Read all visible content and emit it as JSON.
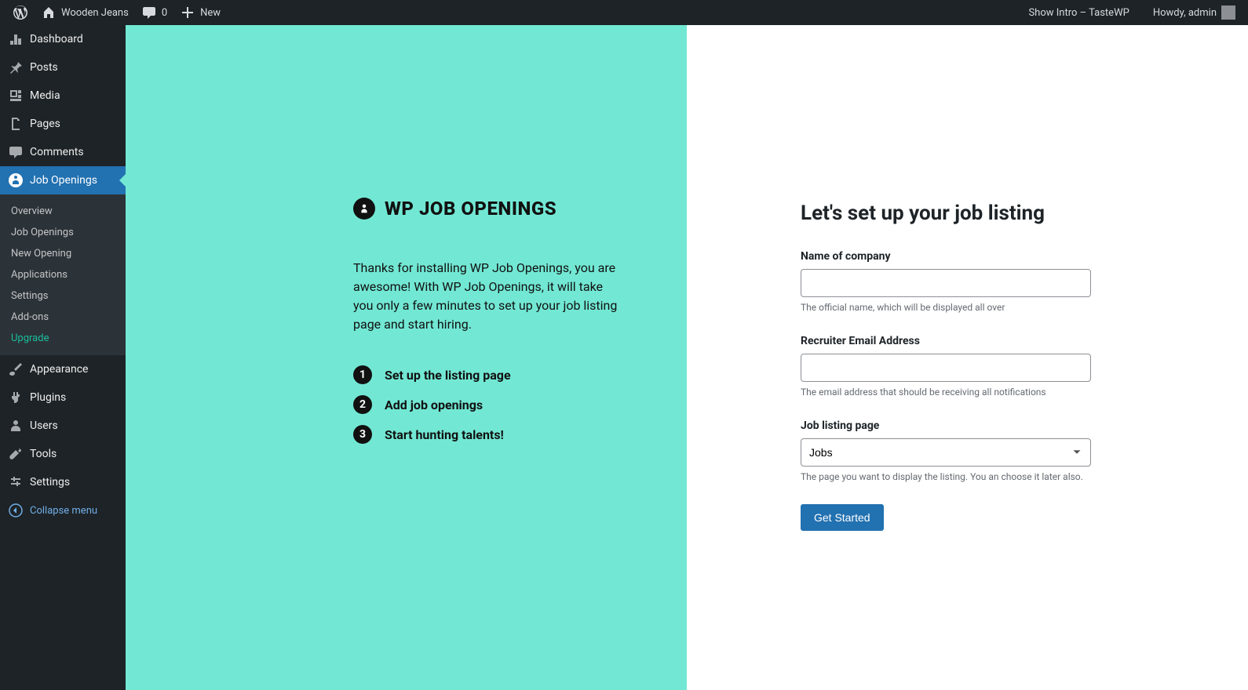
{
  "adminbar": {
    "site_name": "Wooden Jeans",
    "comments_count": "0",
    "new_label": "New",
    "show_intro": "Show Intro – TasteWP",
    "howdy": "Howdy, admin"
  },
  "sidebar": {
    "items": [
      {
        "label": "Dashboard"
      },
      {
        "label": "Posts"
      },
      {
        "label": "Media"
      },
      {
        "label": "Pages"
      },
      {
        "label": "Comments"
      },
      {
        "label": "Job Openings"
      },
      {
        "label": "Appearance"
      },
      {
        "label": "Plugins"
      },
      {
        "label": "Users"
      },
      {
        "label": "Tools"
      },
      {
        "label": "Settings"
      }
    ],
    "submenu": [
      {
        "label": "Overview"
      },
      {
        "label": "Job Openings"
      },
      {
        "label": "New Opening"
      },
      {
        "label": "Applications"
      },
      {
        "label": "Settings"
      },
      {
        "label": "Add-ons"
      },
      {
        "label": "Upgrade"
      }
    ],
    "collapse_label": "Collapse menu"
  },
  "intro": {
    "logo_text": "WP JOB OPENINGS",
    "welcome": "Thanks for installing WP Job Openings, you are awesome! With WP Job Openings, it will take you only a few minutes to set up your job listing page and start hiring.",
    "steps": [
      {
        "num": "1",
        "text": "Set up the listing page"
      },
      {
        "num": "2",
        "text": "Add job openings"
      },
      {
        "num": "3",
        "text": "Start hunting talents!"
      }
    ]
  },
  "form": {
    "title": "Let's set up your job listing",
    "company_label": "Name of company",
    "company_helper": "The official name, which will be displayed all over",
    "email_label": "Recruiter Email Address",
    "email_helper": "The email address that should be receiving all notifications",
    "page_label": "Job listing page",
    "page_selected": "Jobs",
    "page_helper": "The page you want to display the listing. You an choose it later also.",
    "submit_label": "Get Started"
  }
}
